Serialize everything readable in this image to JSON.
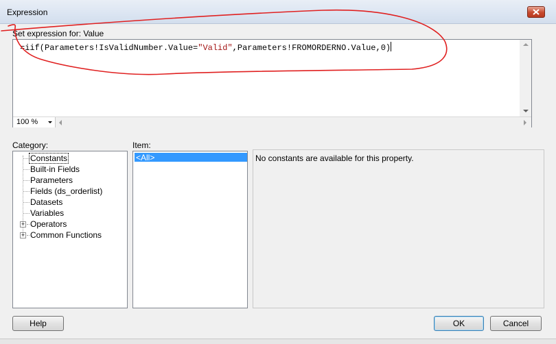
{
  "window": {
    "title": "Expression"
  },
  "expression": {
    "label": "Set expression for: Value",
    "text_prefix": "=iif(Parameters!IsValidNumber.Value=",
    "text_string": "\"Valid\"",
    "text_suffix": ",Parameters!FROMORDERNO.Value,0)",
    "zoom": "100 %"
  },
  "category": {
    "label": "Category:",
    "items": [
      {
        "label": "Constants",
        "selected": true,
        "expandable": false
      },
      {
        "label": "Built-in Fields",
        "expandable": false
      },
      {
        "label": "Parameters",
        "expandable": false
      },
      {
        "label": "Fields (ds_orderlist)",
        "expandable": false
      },
      {
        "label": "Datasets",
        "expandable": false
      },
      {
        "label": "Variables",
        "expandable": false
      },
      {
        "label": "Operators",
        "expandable": true
      },
      {
        "label": "Common Functions",
        "expandable": true
      }
    ]
  },
  "item": {
    "label": "Item:",
    "items": [
      {
        "label": "<All>",
        "selected": true
      }
    ]
  },
  "description": {
    "text": "No constants are available for this property."
  },
  "buttons": {
    "help": "Help",
    "ok": "OK",
    "cancel": "Cancel"
  },
  "colors": {
    "annotation": "#e02020",
    "selection": "#3399ff",
    "string_literal": "#a31515"
  }
}
